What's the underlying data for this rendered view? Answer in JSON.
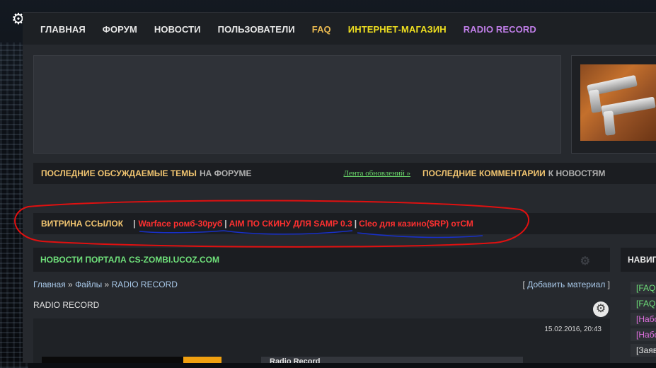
{
  "nav": {
    "items": [
      {
        "label": "ГЛАВНАЯ",
        "color": "#e8e8e8"
      },
      {
        "label": "ФОРУМ",
        "color": "#e8e8e8"
      },
      {
        "label": "НОВОСТИ",
        "color": "#e8e8e8"
      },
      {
        "label": "ПОЛЬЗОВАТЕЛИ",
        "color": "#e8e8e8"
      },
      {
        "label": "FAQ",
        "color": "#e8b850"
      },
      {
        "label": "ИНТЕРНЕТ-МАГАЗИН",
        "color": "#f0e020"
      },
      {
        "label": "RADIO RECORD",
        "color": "#c07ee8"
      }
    ]
  },
  "icons": {
    "settings": "gear-icon"
  },
  "topics_bar": {
    "title_bold": "ПОСЛЕДНИЕ ОБСУЖДАЕМЫЕ ТЕМЫ",
    "title_rest": "НА ФОРУМЕ",
    "feed_link": "Лента обновлений »",
    "comments_bold": "ПОСЛЕДНИЕ КОММЕНТАРИИ",
    "comments_rest": "К НОВОСТЯМ"
  },
  "showcase_bar": {
    "title": "ВИТРИНА ССЫЛОК",
    "separator": "|",
    "links": [
      "Warface ромб-30руб",
      "AIM ПО СКИНУ ДЛЯ SAMP 0.3",
      "Cleo для казино($RP) отСМ"
    ]
  },
  "news": {
    "header": "НОВОСТИ ПОРТАЛА CS-ZOMBI.UCOZ.COM",
    "breadcrumb": [
      "Главная",
      "Файлы",
      "RADIO RECORD"
    ],
    "breadcrumb_sep": "»",
    "add_material": "Добавить материал",
    "section_title": "RADIO RECORD",
    "post_date": "15.02.2016, 20:43",
    "post_title": "Radio Record"
  },
  "sidebar": {
    "header": "НАВИГ",
    "items": [
      {
        "label": "[FAQ",
        "color": "#6fe07a"
      },
      {
        "label": "[FAQ",
        "color": "#6fe07a"
      },
      {
        "label": "[Набо",
        "color": "#e070e0"
      },
      {
        "label": "[Набо",
        "color": "#e070e0"
      },
      {
        "label": "[Заяв",
        "color": "#e8e8e8"
      }
    ]
  },
  "colors": {
    "accent_gold": "#f0c470",
    "link_red": "#ff3030",
    "news_green": "#6fe07a",
    "annotation_red": "#e01010",
    "annotation_blue": "#1830c8"
  }
}
